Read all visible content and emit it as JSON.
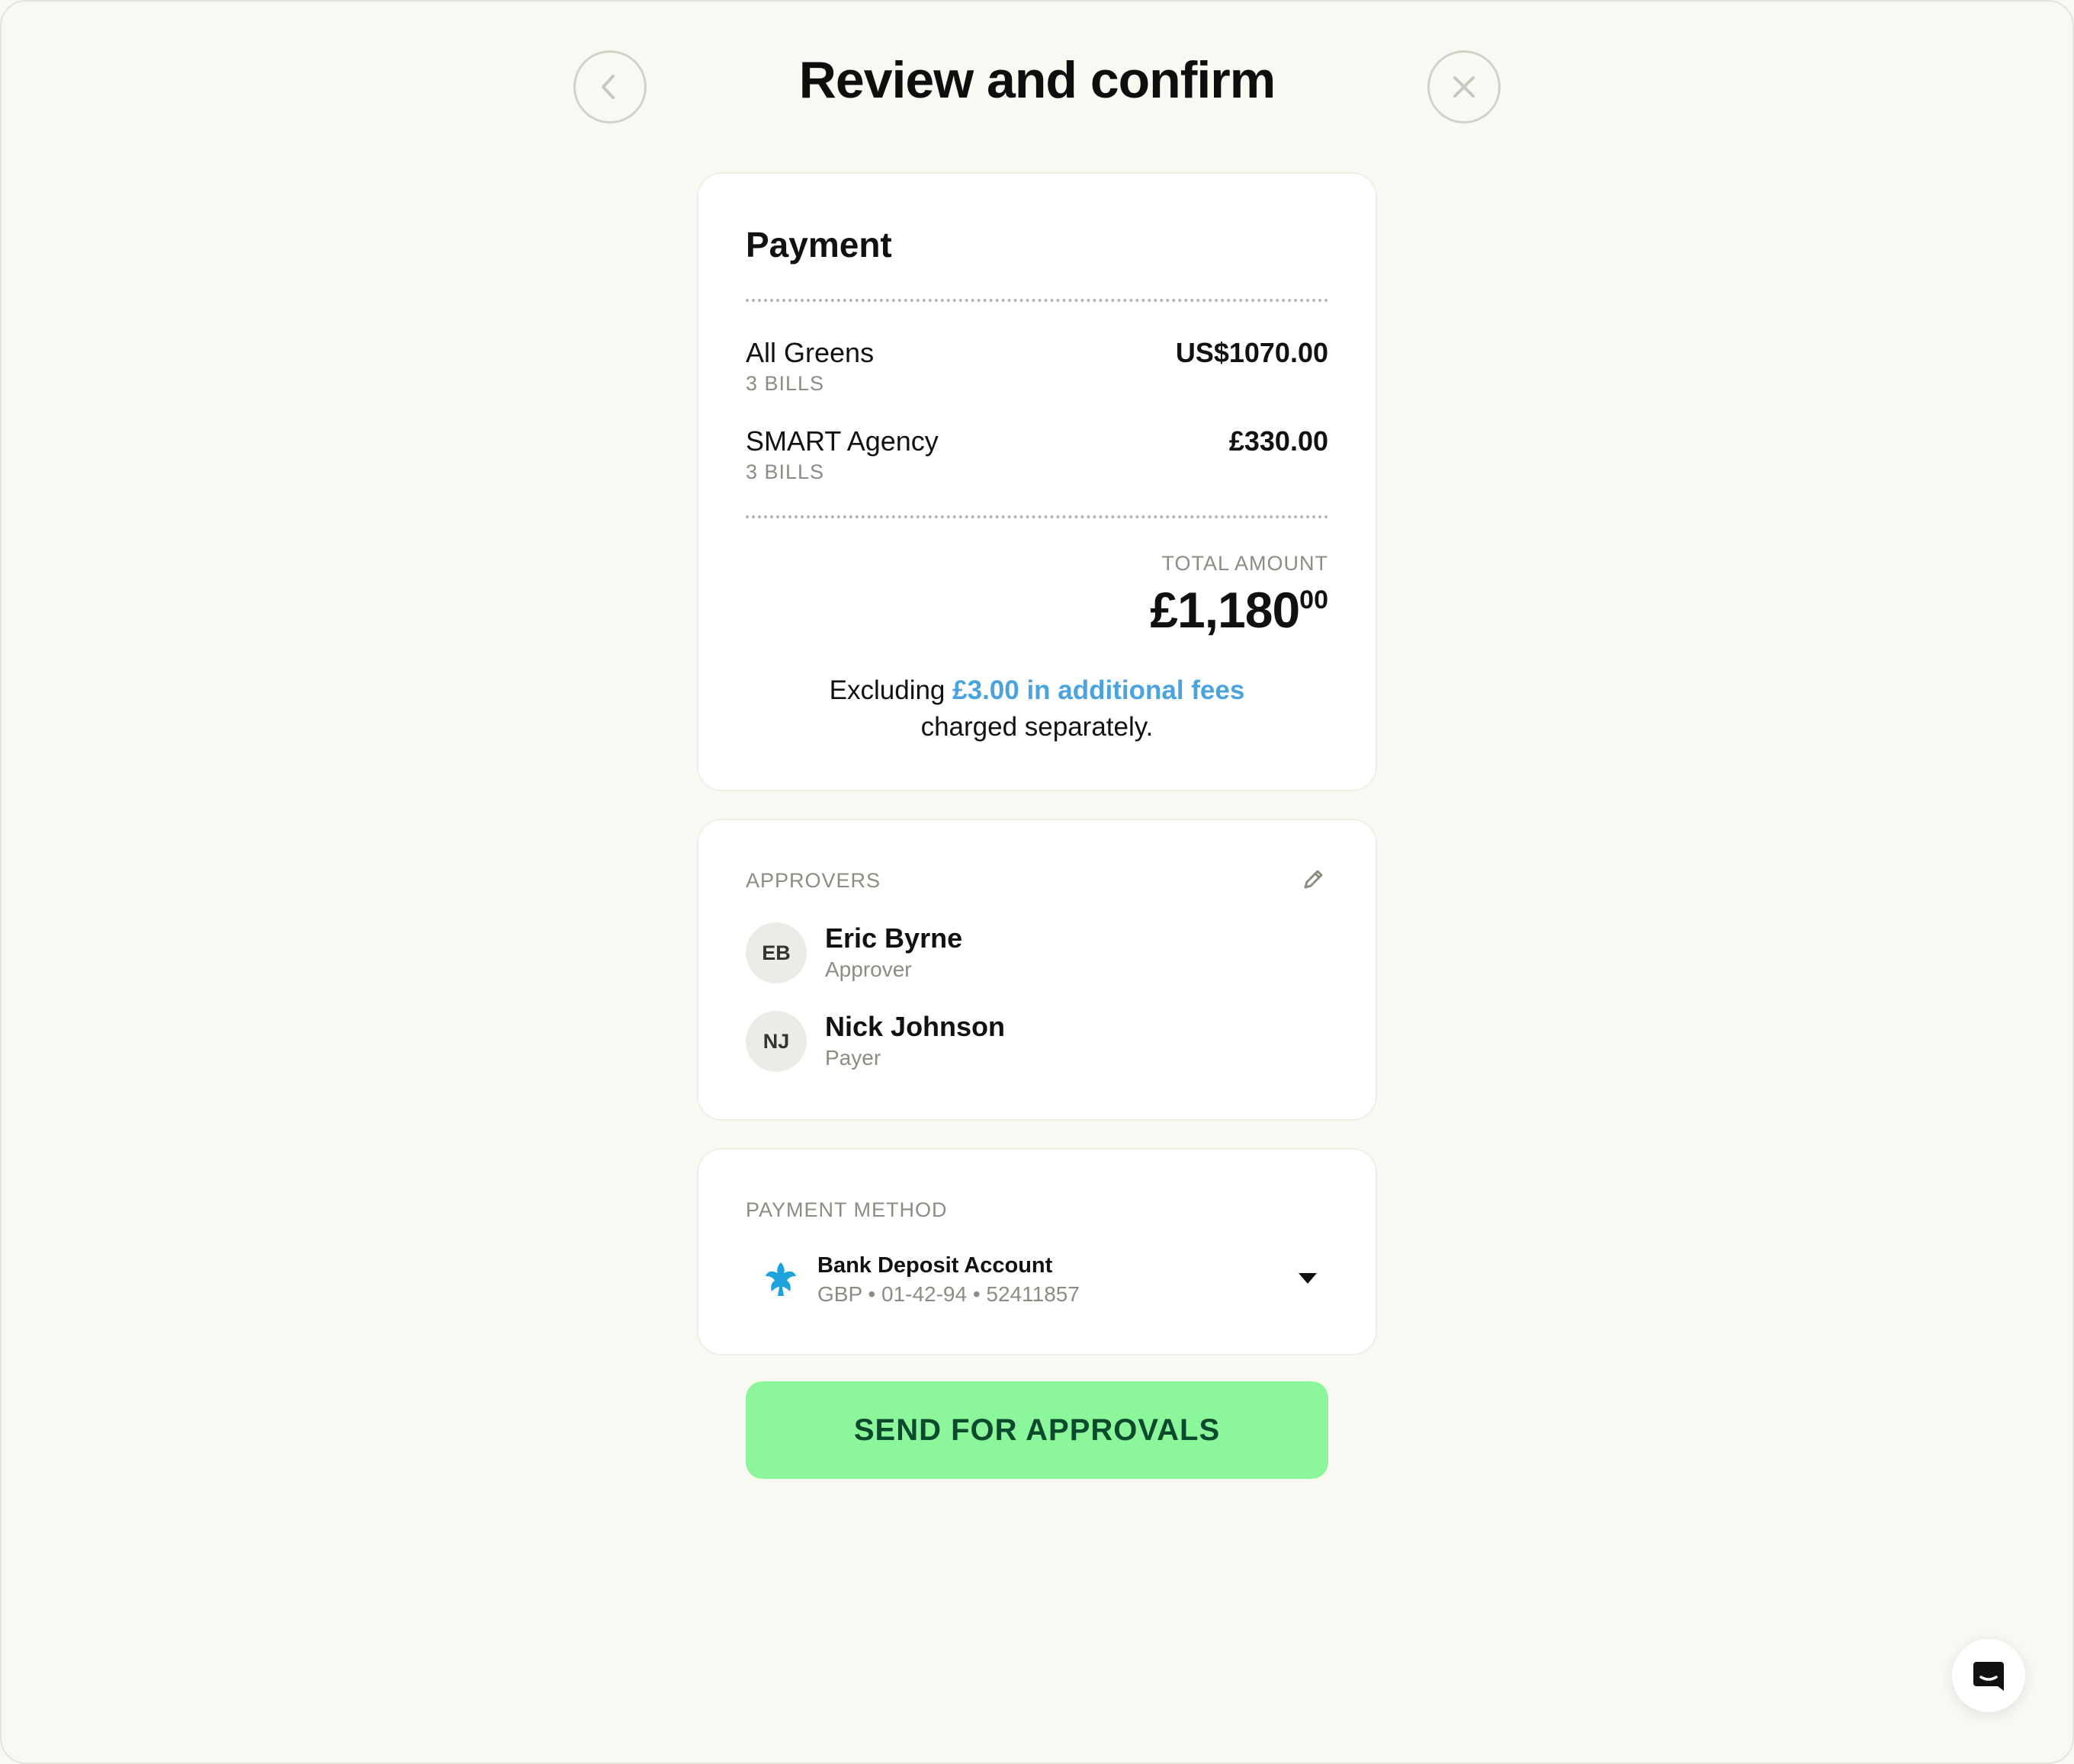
{
  "header": {
    "title": "Review and confirm",
    "back_icon": "chevron-left-icon",
    "close_icon": "close-icon"
  },
  "payment": {
    "title": "Payment",
    "items": [
      {
        "name": "All Greens",
        "sub": "3 BILLS",
        "amount": "US$1070.00"
      },
      {
        "name": "SMART Agency",
        "sub": "3 BILLS",
        "amount": "£330.00"
      }
    ],
    "total_label": "TOTAL AMOUNT",
    "total_main": "£1,180",
    "total_cents": "00",
    "fees_prefix": "Excluding",
    "fees_link": "£3.00 in additional fees",
    "fees_suffix": "charged separately."
  },
  "approvers": {
    "label": "APPROVERS",
    "edit_icon": "pencil-icon",
    "people": [
      {
        "initials": "EB",
        "name": "Eric Byrne",
        "role": "Approver"
      },
      {
        "initials": "NJ",
        "name": "Nick Johnson",
        "role": "Payer"
      }
    ]
  },
  "payment_method": {
    "label": "PAYMENT METHOD",
    "account_name": "Bank Deposit Account",
    "account_details": "GBP • 01-42-94 • 52411857",
    "bank_icon": "eagle-bank-icon",
    "dropdown_icon": "caret-down-icon"
  },
  "cta": {
    "label": "SEND FOR APPROVALS"
  },
  "chat": {
    "icon": "chat-icon"
  },
  "colors": {
    "accent_green": "#8bf79a",
    "cta_text": "#0b4a2c",
    "link_blue": "#4aa3de",
    "background": "#f9f9f4"
  }
}
